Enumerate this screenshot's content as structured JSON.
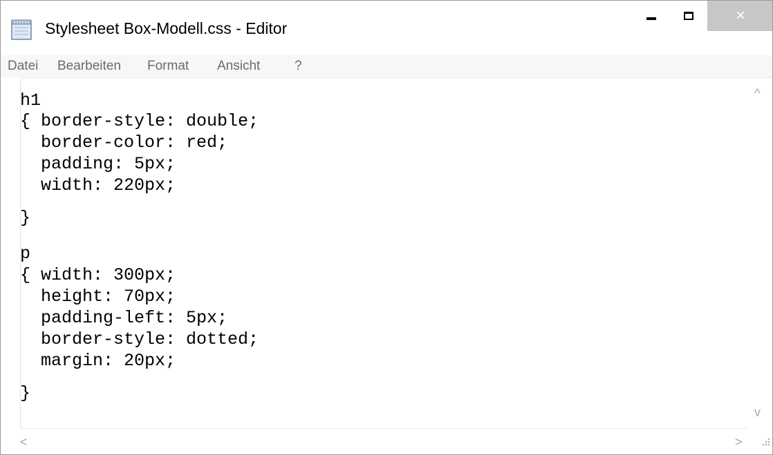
{
  "window": {
    "title": "Stylesheet Box-Modell.css - Editor",
    "app_icon": "notepad-icon",
    "controls": {
      "minimize_icon": "minimize-icon",
      "maximize_icon": "maximize-icon",
      "close_icon": "close-icon",
      "close_glyph": "×"
    }
  },
  "menubar": {
    "items": [
      "Datei",
      "Bearbeiten",
      "Format",
      "Ansicht",
      "?"
    ]
  },
  "editor": {
    "lines": [
      "h1",
      "{ border-style: double;",
      "  border-color: red;",
      "  padding: 5px;",
      "  width: 220px;",
      "}",
      "p",
      "{ width: 300px;",
      "  height: 70px;",
      "  padding-left: 5px;",
      "  border-style: dotted;",
      "  margin: 20px;",
      "}"
    ]
  },
  "scrollbars": {
    "up_arrow": "^",
    "down_arrow": "v",
    "left_arrow": "<",
    "right_arrow": ">"
  },
  "colors": {
    "close_button_bg": "#c7c7c7",
    "menu_text": "#6b6b6b",
    "menubar_bg": "#f7f7f7"
  }
}
